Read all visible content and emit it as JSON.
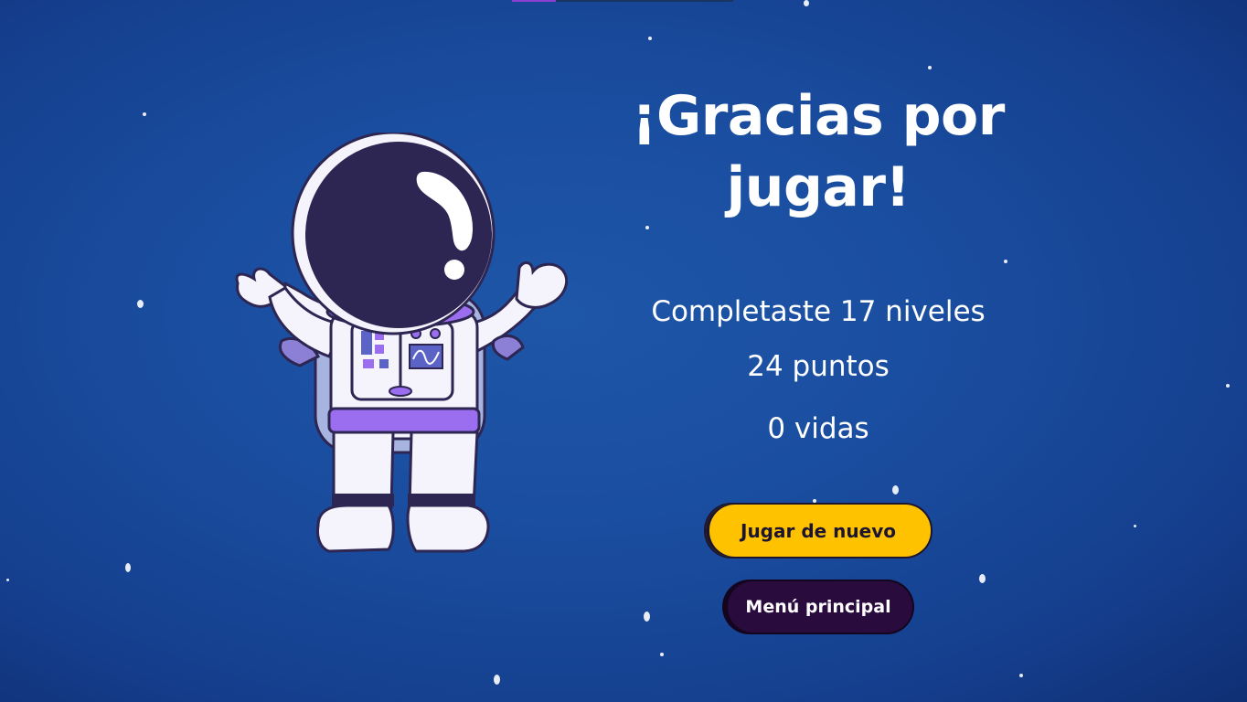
{
  "colors": {
    "background": "#1a4d9f",
    "play_button": "#ffc200",
    "menu_button": "#2a0b3d",
    "suit_accent": "#9b6ef0",
    "visor": "#2d2552"
  },
  "illustration": {
    "icon": "astronaut-icon"
  },
  "end_screen": {
    "title": "¡Gracias por jugar!",
    "levels_completed": "Completaste 17 niveles",
    "points": "24 puntos",
    "lives": "0 vidas"
  },
  "buttons": {
    "play_again": "Jugar de nuevo",
    "main_menu": "Menú principal"
  }
}
